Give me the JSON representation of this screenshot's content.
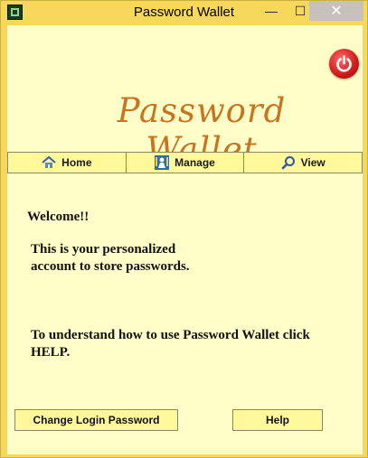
{
  "window": {
    "title": "Password Wallet",
    "minimize_glyph": "—",
    "maximize_glyph": "☐",
    "close_glyph": "✕"
  },
  "brand": {
    "text": "Password Wallet"
  },
  "nav": {
    "items": [
      {
        "label": "Home",
        "icon": "home-icon"
      },
      {
        "label": "Manage",
        "icon": "manage-icon"
      },
      {
        "label": "View",
        "icon": "search-icon"
      }
    ]
  },
  "main": {
    "welcome": "Welcome!!",
    "description": "This is your personalized account to store passwords.",
    "help_text": "To understand how to use Password Wallet click HELP."
  },
  "buttons": {
    "change_password": "Change Login Password",
    "help": "Help"
  },
  "colors": {
    "frame": "#f8d85a",
    "content_bg": "#fffdc8",
    "nav_bg": "#fff99c",
    "brand": "#c8741e",
    "power_red": "#d01818"
  }
}
